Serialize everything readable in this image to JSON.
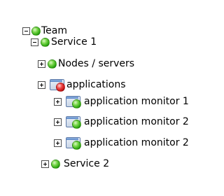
{
  "tree": {
    "team": {
      "label": "Team",
      "status": "green",
      "expanded": true
    },
    "service1": {
      "label": "Service 1",
      "status": "green",
      "expanded": true
    },
    "nodes": {
      "label": "Nodes / servers",
      "status": "green",
      "expanded": false
    },
    "applications": {
      "label": "applications",
      "status": "red",
      "expanded": false
    },
    "monitors": [
      {
        "label": "application monitor 1",
        "status": "green",
        "expanded": false
      },
      {
        "label": "application monitor 2",
        "status": "green",
        "expanded": false
      },
      {
        "label": "application monitor 2",
        "status": "green",
        "expanded": false
      }
    ],
    "service2": {
      "label": "Service 2",
      "status": "green",
      "expanded": false
    }
  },
  "colors": {
    "ok": "#2ea812",
    "error": "#c81414"
  }
}
